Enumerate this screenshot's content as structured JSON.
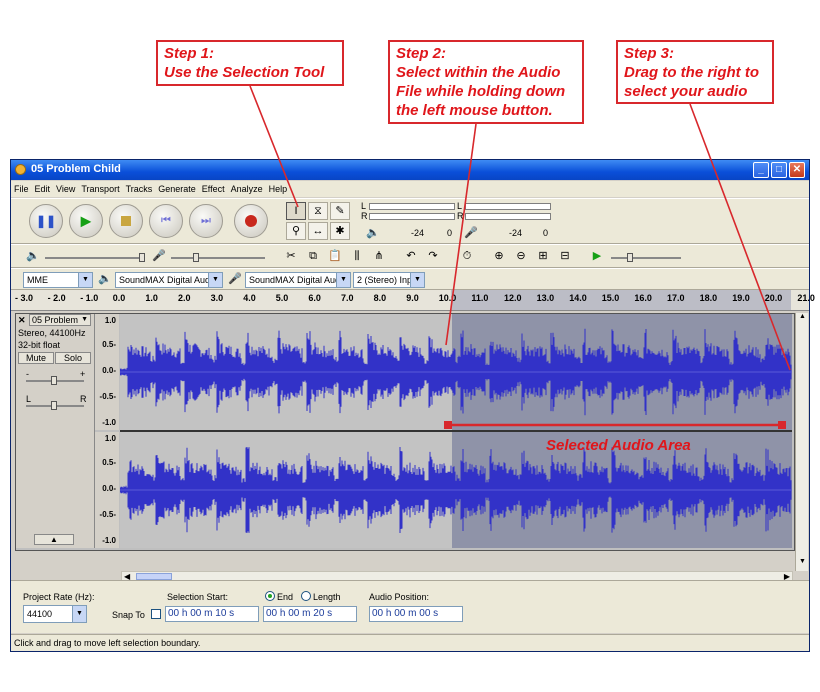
{
  "callouts": {
    "step1": {
      "line1": "Step 1:",
      "line2": "Use the Selection Tool"
    },
    "step2": {
      "line1": "Step 2:",
      "line2": "Select within the Audio",
      "line3": "File while holding down",
      "line4": "the left mouse button."
    },
    "step3": {
      "line1": "Step 3:",
      "line2": "Drag to the right to",
      "line3": "select your audio"
    },
    "selected_area": "Selected Audio Area"
  },
  "window": {
    "title": "05 Problem Child"
  },
  "menu": [
    "File",
    "Edit",
    "View",
    "Transport",
    "Tracks",
    "Generate",
    "Effect",
    "Analyze",
    "Help"
  ],
  "meters": {
    "left": "L",
    "right": "R",
    "db1": "-24",
    "db2": "0",
    "db3": "-24",
    "db4": "0"
  },
  "devices": {
    "host": "MME",
    "output": "SoundMAX Digital Audio",
    "input": "SoundMAX Digital Audio",
    "channels": "2 (Stereo) Inp"
  },
  "ruler": [
    "- 3.0",
    "- 2.0",
    "- 1.0",
    "0.0",
    "1.0",
    "2.0",
    "3.0",
    "4.0",
    "5.0",
    "6.0",
    "7.0",
    "8.0",
    "9.0",
    "10.0",
    "11.0",
    "12.0",
    "13.0",
    "14.0",
    "15.0",
    "16.0",
    "17.0",
    "18.0",
    "19.0",
    "20.0",
    "21.0"
  ],
  "track": {
    "name": "05 Problem",
    "info1": "Stereo, 44100Hz",
    "info2": "32-bit float",
    "mute": "Mute",
    "solo": "Solo",
    "pan_l": "L",
    "pan_r": "R",
    "gain_minus": "-",
    "gain_plus": "+",
    "scale": [
      "1.0",
      "0.5-",
      "0.0-",
      "-0.5-",
      "-1.0"
    ]
  },
  "selection_fraction": {
    "start": 0.494,
    "end": 1.0
  },
  "bottom": {
    "project_rate_label": "Project Rate (Hz):",
    "project_rate": "44100",
    "snap_to": "Snap To",
    "selection_start_label": "Selection Start:",
    "end_label": "End",
    "length_label": "Length",
    "audio_position_label": "Audio Position:",
    "selection_start": "00 h 00 m 10 s",
    "selection_end": "00 h 00 m 20 s",
    "audio_position": "00 h 00 m 00 s"
  },
  "status": "Click and drag to move left selection boundary.",
  "colors": {
    "callout": "#e0161b",
    "wave": "#3232c8",
    "selection": "#8f93a8",
    "title_bar": "#0a4fd9"
  }
}
